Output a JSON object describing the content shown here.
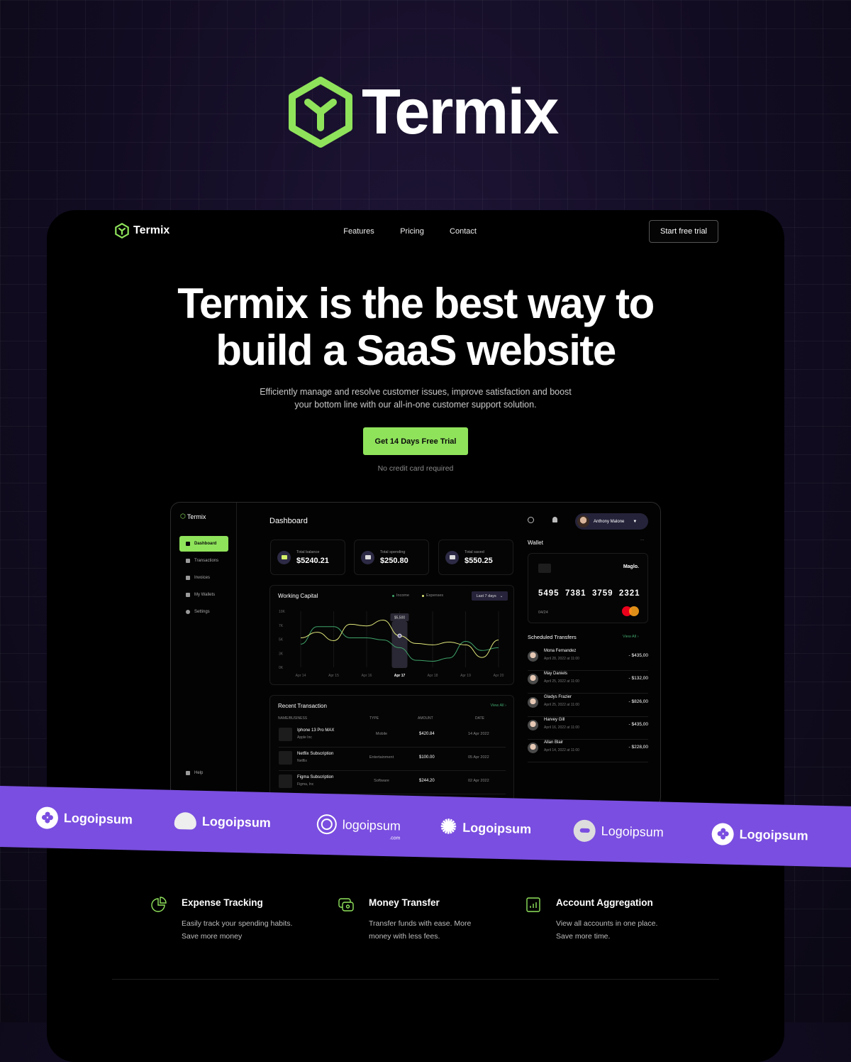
{
  "brand": {
    "name": "Termix",
    "accent": "#8fe35b"
  },
  "nav": {
    "logo": "Termix",
    "links": [
      "Features",
      "Pricing",
      "Contact"
    ],
    "cta": "Start free trial"
  },
  "hero": {
    "title_line1": "Termix is the best way to",
    "title_line2": "build a SaaS website",
    "subtitle_line1": "Efficiently manage and resolve customer issues, improve satisfaction and boost",
    "subtitle_line2": "your bottom line with our all-in-one customer support solution.",
    "cta": "Get 14 Days Free Trial",
    "note": "No credit card required"
  },
  "dashboard": {
    "logo": "Termix",
    "title": "Dashboard",
    "sidebar": [
      {
        "label": "Dashboard",
        "icon": "home-icon",
        "active": true
      },
      {
        "label": "Transactions",
        "icon": "chart-icon"
      },
      {
        "label": "Invoices",
        "icon": "invoice-icon"
      },
      {
        "label": "My Wallets",
        "icon": "wallet-icon"
      },
      {
        "label": "Settings",
        "icon": "gear-icon"
      }
    ],
    "help": "Help",
    "user": "Anthony Malone",
    "stats": [
      {
        "label": "Total balance",
        "value": "$5240.21",
        "icon": "wallet-icon"
      },
      {
        "label": "Total spending",
        "value": "$250.80",
        "icon": "card-icon"
      },
      {
        "label": "Total saved",
        "value": "$550.25",
        "icon": "piggy-icon"
      }
    ],
    "working_capital": {
      "title": "Working Capital",
      "legend": [
        "Income",
        "Expenses"
      ],
      "colors": {
        "income": "#3fa36a",
        "expenses": "#e1e87a"
      },
      "range": "Last 7 days",
      "y_labels": [
        "10K",
        "7K",
        "5K",
        "3K",
        "0K"
      ],
      "x_labels": [
        "Apr 14",
        "Apr 15",
        "Apr 16",
        "Apr 17",
        "Apr 18",
        "Apr 19",
        "Apr 20"
      ],
      "highlight": "Apr 17",
      "tooltip": "$5,500",
      "income": [
        4.3,
        6.8,
        6.8,
        5.2,
        5.2,
        4.9,
        3.8,
        1.5,
        1.3,
        2.0,
        4.7,
        3.4,
        3.8
      ],
      "expenses": [
        5.2,
        6.0,
        4.8,
        7.2,
        6.9,
        8.1,
        5.5,
        4.4,
        4.2,
        4.6,
        4.2,
        2.1,
        4.9
      ]
    },
    "recent": {
      "title": "Recent Transaction",
      "view_all": "View All",
      "headers": [
        "NAME/BUSINESS",
        "TYPE",
        "AMOUNT",
        "DATE"
      ],
      "rows": [
        {
          "name": "Iphone 13 Pro MAX",
          "business": "Apple Inc",
          "type": "Mobile",
          "amount": "$420.84",
          "date": "14 Apr 2022"
        },
        {
          "name": "Netflix Subscription",
          "business": "Netflix",
          "type": "Entertainment",
          "amount": "$100.00",
          "date": "05 Apr 2022"
        },
        {
          "name": "Figma Subscription",
          "business": "Figma, Inc",
          "type": "Software",
          "amount": "$244.20",
          "date": "02 Apr 2022"
        }
      ]
    },
    "wallet": {
      "title": "Wallet",
      "card_brand": "Maglo.",
      "number": "5495  7381  3759  2321",
      "expiry": "04/24",
      "network": "mastercard"
    },
    "transfers": {
      "title": "Scheduled Transfers",
      "view_all": "View All",
      "rows": [
        {
          "name": "Mona Fernandez",
          "date": "April 28, 2022 at 11:00",
          "amount": "- $435,00"
        },
        {
          "name": "May Daniels",
          "date": "April 25, 2022 at 11:00",
          "amount": "- $132,00"
        },
        {
          "name": "Gladys Frazier",
          "date": "April 25, 2022 at 11:00",
          "amount": "- $826,00"
        },
        {
          "name": "Harvey Gill",
          "date": "April 16, 2022 at 11:00",
          "amount": "- $435,00"
        },
        {
          "name": "Allan Blair",
          "date": "April 14, 2022 at 11:00",
          "amount": "- $228,00"
        }
      ]
    }
  },
  "logos": {
    "color": "#7a4ee0",
    "items": [
      "Logoipsum",
      "Logoipsum",
      "logoipsum",
      "Logoipsum",
      "Logoipsum",
      "Logoipsum"
    ],
    "suffix": ".com"
  },
  "features": [
    {
      "title": "Expense Tracking",
      "line1": "Easily track your spending habits.",
      "line2": "Save more money",
      "icon": "pie-chart-icon"
    },
    {
      "title": "Money Transfer",
      "line1": "Transfer funds with ease. More",
      "line2": "money with less fees.",
      "icon": "money-transfer-icon"
    },
    {
      "title": "Account Aggregation",
      "line1": "View all accounts in one place.",
      "line2": "Save more time.",
      "icon": "bar-chart-icon"
    }
  ]
}
